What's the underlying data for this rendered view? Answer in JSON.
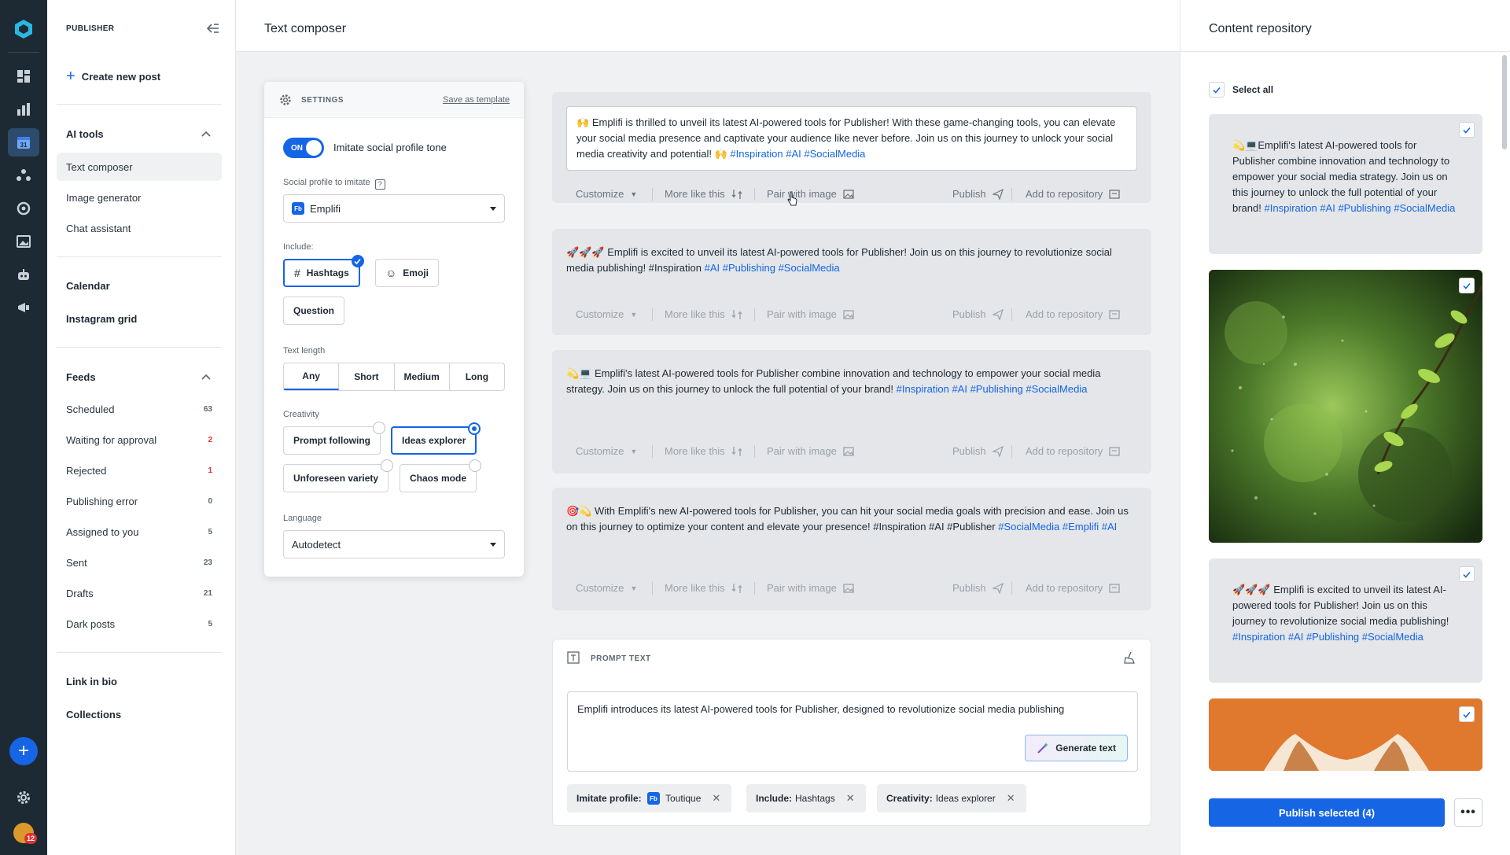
{
  "nav": {
    "brand": "PUBLISHER",
    "create_label": "Create new post",
    "ai_tools_label": "AI tools",
    "ai_items": [
      {
        "label": "Text composer"
      },
      {
        "label": "Image generator"
      },
      {
        "label": "Chat assistant"
      }
    ],
    "calendar_label": "Calendar",
    "instagram_label": "Instagram grid",
    "feeds_label": "Feeds",
    "feeds": [
      {
        "label": "Scheduled",
        "count": "63"
      },
      {
        "label": "Waiting for approval",
        "count": "2"
      },
      {
        "label": "Rejected",
        "count": "1"
      },
      {
        "label": "Publishing error",
        "count": "0"
      },
      {
        "label": "Assigned to you",
        "count": "5"
      },
      {
        "label": "Sent",
        "count": "23"
      },
      {
        "label": "Drafts",
        "count": "21"
      },
      {
        "label": "Dark posts",
        "count": "5"
      }
    ],
    "link_in_bio_label": "Link in bio",
    "collections_label": "Collections"
  },
  "rail": {
    "avatar_badge": "12"
  },
  "header": {
    "title": "Text composer"
  },
  "settings": {
    "title": "SETTINGS",
    "save_template": "Save as template",
    "toggle_state": "ON",
    "toggle_label": "Imitate social profile tone",
    "profile_label": "Social profile to imitate",
    "profile_badge": "Fb",
    "profile_value": "Emplifi",
    "include_label": "Include:",
    "include_options": [
      "Hashtags",
      "Emoji",
      "Question"
    ],
    "length_label": "Text length",
    "length_options": [
      "Any",
      "Short",
      "Medium",
      "Long"
    ],
    "creativity_label": "Creativity",
    "creativity_options": [
      "Prompt following",
      "Ideas explorer",
      "Unforeseen variety",
      "Chaos mode"
    ],
    "language_label": "Language",
    "language_value": "Autodetect"
  },
  "actions": {
    "customize": "Customize",
    "more_like": "More like this",
    "pair_image": "Pair with image",
    "publish": "Publish",
    "add_repo": "Add to repository"
  },
  "generated": [
    {
      "emoji": "🙌",
      "text": "Emplifi is thrilled to unveil its latest AI-powered tools for Publisher! With these game-changing tools, you can elevate your social media presence and captivate your audience like never before. Join us on this journey to unlock your social media creativity and potential! 🙌",
      "tags": "#Inspiration #AI #SocialMedia"
    },
    {
      "emoji": "🚀🚀🚀",
      "text": "Emplifi is excited to unveil its latest AI-powered tools for Publisher! Join us on this journey to revolutionize social media publishing! #Inspiration",
      "tags": "#AI #Publishing #SocialMedia"
    },
    {
      "emoji": "💫💻",
      "text": "Emplifi's latest AI-powered tools for Publisher combine innovation and technology to empower your social media strategy. Join us on this journey to unlock the full potential of your brand!",
      "tags": "#Inspiration #AI #Publishing #SocialMedia"
    },
    {
      "emoji": "🎯💫",
      "text": "With Emplifi's new AI-powered tools for Publisher, you can hit your social media goals with precision and ease. Join us on this journey to optimize your content and elevate your presence! #Inspiration #AI #Publisher",
      "tags": "#SocialMedia #Emplifi #AI"
    }
  ],
  "prompt": {
    "title": "PROMPT TEXT",
    "text": "Emplifi introduces its latest AI-powered tools for Publisher, designed to revolutionize social media publishing",
    "generate_label": "Generate text",
    "pills": [
      {
        "key": "Imitate profile:",
        "badge": "Fb",
        "value": "Toutique"
      },
      {
        "key": "Include:",
        "value": "Hashtags"
      },
      {
        "key": "Creativity:",
        "value": "Ideas explorer"
      }
    ]
  },
  "repository": {
    "title": "Content repository",
    "select_all": "Select all",
    "cards": [
      {
        "emoji": "💫💻",
        "text": "Emplifi's latest AI-powered tools for Publisher combine innovation and technology to empower your social media strategy. Join us on this journey to unlock the full potential of your brand!",
        "tags": "#Inspiration #AI #Publishing #SocialMedia"
      },
      {
        "emoji": "🚀🚀🚀",
        "text": "Emplifi is excited to unveil its latest AI-powered tools for Publisher! Join us on this journey to revolutionize social media publishing!",
        "tags": "#Inspiration #AI #Publishing #SocialMedia"
      }
    ],
    "publish_selected": "Publish selected (4)",
    "more_label": "•••"
  },
  "colors": {
    "accent": "#1565e5",
    "rail": "#1e2a33",
    "hashtag": "#1565e5"
  }
}
